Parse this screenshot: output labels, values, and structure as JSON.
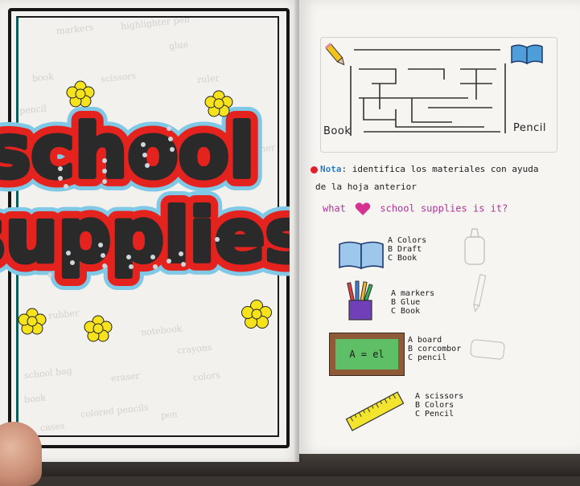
{
  "cover": {
    "title_line1": "school",
    "title_line2": "supplies",
    "ghost_words": [
      "markers",
      "highlighter pen",
      "glue",
      "book",
      "scissors",
      "ruler",
      "pencil",
      "sharpener",
      "rubber",
      "notebook",
      "crayons",
      "school bag",
      "eraser",
      "colors",
      "book",
      "colored pencils",
      "pen",
      "cases"
    ]
  },
  "maze": {
    "start_label": "Book",
    "end_label": "Pencil"
  },
  "note": {
    "head": "Nota",
    "line1_rest": ": identifica los materiales con ayuda",
    "line2": "de la hoja anterior",
    "question_start": "what",
    "question_end": "school supplies is it?"
  },
  "questions": [
    {
      "options": [
        "A Colors",
        "B Draft",
        "C Book"
      ]
    },
    {
      "options": [
        "A markers",
        "B Glue",
        "C Book"
      ]
    },
    {
      "options": [
        "A board",
        "B corcombor",
        "C pencil"
      ]
    },
    {
      "options": [
        "A scissors",
        "B Colors",
        "C Pencil"
      ]
    }
  ],
  "board_text": "A = el"
}
